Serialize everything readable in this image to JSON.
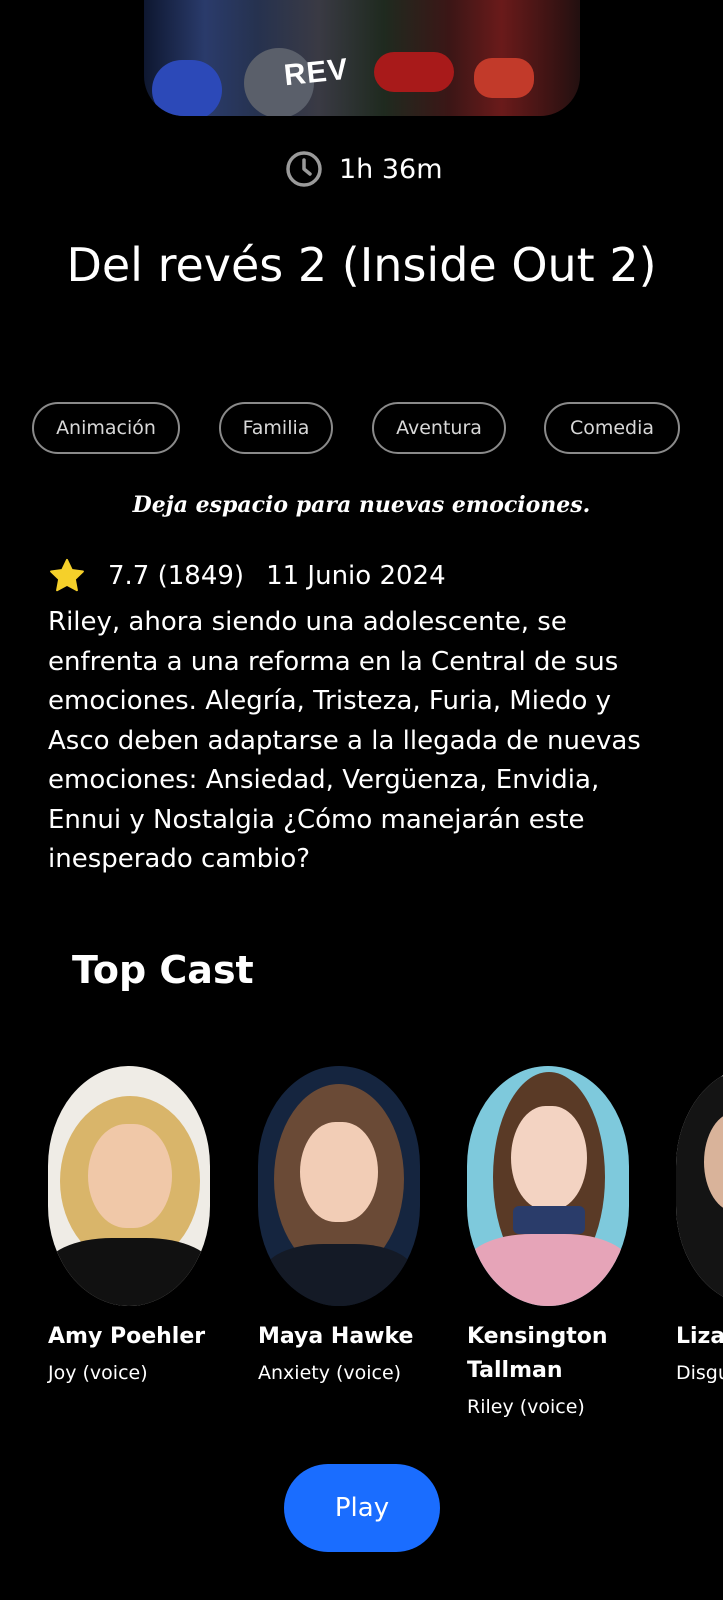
{
  "poster": {
    "title_fragment": "REV"
  },
  "duration": {
    "icon": "clock-icon",
    "text": "1h 36m"
  },
  "movie": {
    "title": "Del revés 2 (Inside Out 2)",
    "genres": [
      "Animación",
      "Familia",
      "Aventura",
      "Comedia"
    ],
    "tagline": "Deja espacio para nuevas emociones.",
    "rating_icon": "star-icon",
    "rating": "7.7 (1849)",
    "release_date": "11 Junio 2024",
    "overview": "Riley, ahora siendo una adolescente, se enfrenta a una reforma en la Central de sus emociones. Alegría, Tristeza, Furia, Miedo y Asco deben adaptarse a la llegada de nuevas emociones: Ansiedad, Vergüenza, Envidia, Ennui y Nostalgia  ¿Cómo manejarán este inesperado cambio?"
  },
  "cast": {
    "title": "Top Cast",
    "members": [
      {
        "name": "Amy Poehler",
        "role": "Joy (voice)"
      },
      {
        "name": "Maya Hawke",
        "role": "Anxiety (voice)"
      },
      {
        "name": "Kensington Tallman",
        "role": "Riley (voice)"
      },
      {
        "name": "Liza",
        "role": "Disgu"
      }
    ]
  },
  "actions": {
    "play_label": "Play"
  },
  "colors": {
    "background": "#000000",
    "accent": "#1a6dff",
    "star": "#f5d02a",
    "chip_border": "#8a8a8a"
  }
}
